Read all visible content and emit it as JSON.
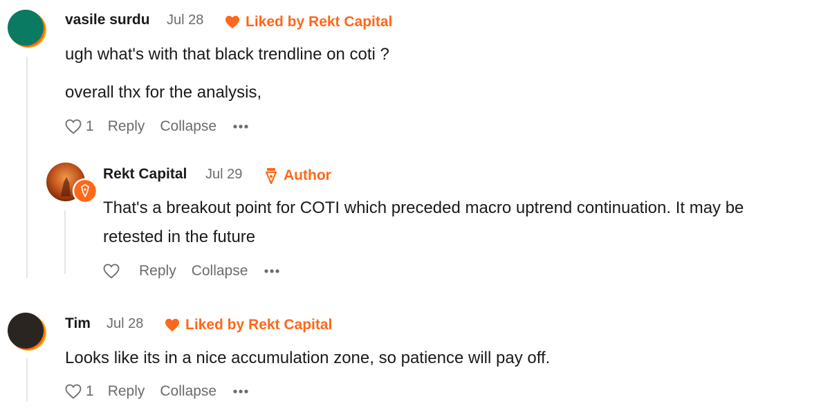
{
  "comments": [
    {
      "author": "vasile surdu",
      "date": "Jul 28",
      "badge": "Liked by Rekt Capital",
      "paragraphs": [
        "ugh what's with that black trendline on coti ?",
        "overall thx for the analysis,"
      ],
      "like_count": "1",
      "reply_label": "Reply",
      "collapse_label": "Collapse",
      "avatar_colors": [
        "#0b7a63",
        "#ff6719",
        "#f0b400"
      ],
      "reply": {
        "author": "Rekt Capital",
        "date": "Jul 29",
        "badge": "Author",
        "paragraphs": [
          "That's a breakout point for COTI which preceded macro uptrend continuation. It may be",
          "retested in the future"
        ],
        "like_count": "",
        "reply_label": "Reply",
        "collapse_label": "Collapse"
      }
    },
    {
      "author": "Tim",
      "date": "Jul 28",
      "badge": "Liked by Rekt Capital",
      "paragraphs": [
        "Looks like its in a nice accumulation zone, so patience will pay off."
      ],
      "like_count": "1",
      "reply_label": "Reply",
      "collapse_label": "Collapse",
      "avatar_colors": [
        "#2a2520",
        "#ff6719",
        "#f0b400"
      ]
    }
  ],
  "colors": {
    "accent": "#ff6719",
    "muted": "#6b6b6b",
    "text": "#1a1a1a"
  },
  "icons": {
    "badge_liked": "heart-icon",
    "badge_author": "pen-nib-icon",
    "like": "heart-outline-icon",
    "more": "more-dots-icon"
  }
}
